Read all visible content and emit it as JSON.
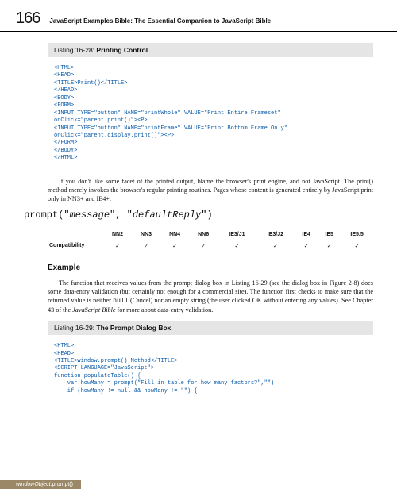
{
  "header": {
    "page_number": "166",
    "chapter_title": "JavaScript Examples Bible: The Essential Companion to JavaScript Bible"
  },
  "listing_1": {
    "label": "Listing 16-28:",
    "title": "Printing Control",
    "code": "<HTML>\n<HEAD>\n<TITLE>Print()</TITLE>\n</HEAD>\n<BODY>\n<FORM>\n<INPUT TYPE=\"button\" NAME=\"printWhole\" VALUE=\"Print Entire Frameset\"\nonClick=\"parent.print()\"><P>\n<INPUT TYPE=\"button\" NAME=\"printFrame\" VALUE=\"Print Bottom Frame Only\"\nonClick=\"parent.display.print()\"><P>\n</FORM>\n</BODY>\n</HTML>"
  },
  "para_1": "If you don't like some facet of the printed output, blame the browser's print engine, and not JavaScript. The print() method merely invokes the browser's regular printing routines. Pages whose content is generated entirely by JavaScript print only in NN3+ and IE4+.",
  "prompt_signature": {
    "open": "prompt(\"",
    "arg1": "message",
    "mid": "\", \"",
    "arg2": "defaultReply",
    "close": "\")"
  },
  "compat": {
    "row_label": "Compatibility",
    "cols": [
      "NN2",
      "NN3",
      "NN4",
      "NN6",
      "IE3/J1",
      "IE3/J2",
      "IE4",
      "IE5",
      "IE5.5"
    ],
    "vals": [
      "✓",
      "✓",
      "✓",
      "✓",
      "✓",
      "✓",
      "✓",
      "✓",
      "✓"
    ]
  },
  "example_heading": "Example",
  "para_2a": "The function that receives values from the prompt dialog box in Listing 16-29 (see the dialog box in Figure 2-8) does some data-entry validation (but certainly not enough for a commercial site). The function first checks to make sure that the returned value is neither ",
  "para_2_code": "null",
  "para_2b": " (Cancel) nor an empty string (the user clicked OK without entering any values). See Chapter 43 of the ",
  "para_2_ital": "JavaScript Bible",
  "para_2c": " for more about data-entry validation.",
  "listing_2": {
    "label": "Listing 16-29:",
    "title": "The Prompt Dialog Box",
    "code": "<HTML>\n<HEAD>\n<TITLE>window.prompt() Method</TITLE>\n<SCRIPT LANGUAGE=\"JavaScript\">\nfunction populateTable() {\n    var howMany = prompt(\"Fill in table for how many factors?\",\"\")\n    if (howMany != null && howMany != \"\") {"
  },
  "footer": {
    "object": "windowObject",
    "method": ".prompt()"
  }
}
